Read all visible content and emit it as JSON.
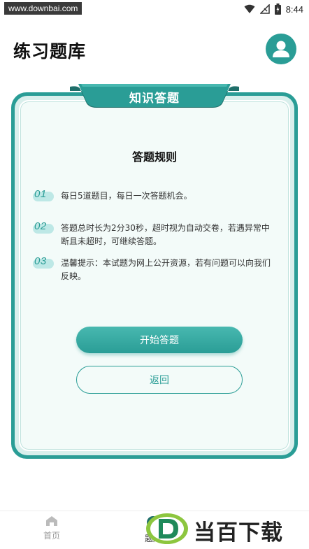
{
  "status_bar": {
    "watermark": "www.downbai.com",
    "time": "8:44"
  },
  "header": {
    "title": "练习题库",
    "avatar_icon": "user-icon"
  },
  "card": {
    "tab_label": "知识答题",
    "rules_title": "答题规则",
    "rules": [
      {
        "num": "01",
        "text": "每日5道题目，每日一次答题机会。"
      },
      {
        "num": "02",
        "text": "答题总时长为2分30秒，超时视为自动交卷，若遇异常中断且未超时，可继续答题。"
      },
      {
        "num": "03",
        "text": "温馨提示：本试题为网上公开资源，若有问题可以向我们反映。"
      }
    ],
    "start_button": "开始答题",
    "back_button": "返回"
  },
  "bottom_nav": {
    "items": [
      {
        "label": "首页",
        "icon": "home-icon"
      },
      {
        "label": "题库",
        "icon": "question-bank-icon"
      }
    ]
  },
  "brand": {
    "text": "当百下载"
  },
  "colors": {
    "accent": "#2a9d96",
    "card_bg": "#f3fbf9"
  }
}
